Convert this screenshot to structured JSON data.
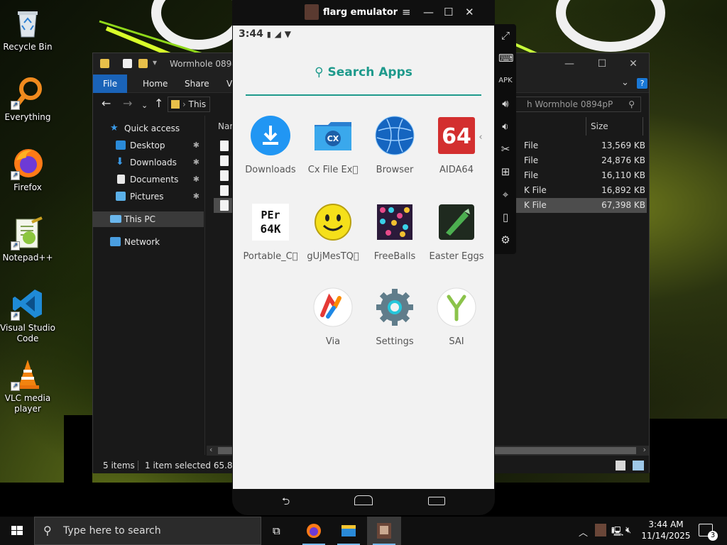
{
  "desktop": {
    "icons": [
      {
        "label": "Recycle Bin"
      },
      {
        "label": "Everything"
      },
      {
        "label": "Firefox"
      },
      {
        "label": "Notepad++"
      },
      {
        "label": "Visual Studio Code"
      },
      {
        "label": "VLC media player"
      }
    ]
  },
  "explorer": {
    "title": "Wormhole 0894p",
    "ribbon_tabs": [
      "File",
      "Home",
      "Share",
      "Vi"
    ],
    "address": "This PC",
    "search_placeholder": "h Wormhole 0894pP",
    "nav": [
      {
        "label": "Quick access",
        "icon": "star-icon"
      },
      {
        "label": "Desktop",
        "icon": "desktop-folder-icon"
      },
      {
        "label": "Downloads",
        "icon": "downloads-folder-icon"
      },
      {
        "label": "Documents",
        "icon": "documents-folder-icon"
      },
      {
        "label": "Pictures",
        "icon": "pictures-folder-icon"
      },
      {
        "label": "This PC",
        "icon": "computer-icon"
      },
      {
        "label": "Network",
        "icon": "network-icon"
      }
    ],
    "columns": {
      "name": "Nar",
      "size": "Size"
    },
    "files": [
      {
        "type": "File",
        "size": "13,569 KB",
        "selected": false
      },
      {
        "type": "File",
        "size": "24,876 KB",
        "selected": false
      },
      {
        "type": "File",
        "size": "16,110 KB",
        "selected": false
      },
      {
        "type": "K File",
        "size": "16,892 KB",
        "selected": false
      },
      {
        "type": "K File",
        "size": "67,398 KB",
        "selected": true
      }
    ],
    "status": {
      "items": "5 items",
      "selected": "1 item selected  65.8 MB"
    }
  },
  "emulator": {
    "title": "flarg emulator",
    "status_time": "3:44",
    "search_label": "Search Apps",
    "apps": [
      {
        "label": "Downloads",
        "icon": "download-icon"
      },
      {
        "label": "Cx File Ex⃞",
        "icon": "cx-file-explorer-icon"
      },
      {
        "label": "Browser",
        "icon": "browser-globe-icon"
      },
      {
        "label": "AIDA64",
        "icon": "aida64-icon"
      },
      {
        "label": "Portable_C⃞",
        "icon": "perf64k-icon"
      },
      {
        "label": "gUjMesTQ⃞",
        "icon": "smiley-icon"
      },
      {
        "label": "FreeBalls",
        "icon": "freeballs-icon"
      },
      {
        "label": "Easter Eggs",
        "icon": "easter-eggs-icon"
      },
      {
        "label": "Via",
        "icon": "via-browser-icon"
      },
      {
        "label": "Settings",
        "icon": "settings-gear-icon"
      },
      {
        "label": "SAI",
        "icon": "sai-icon"
      }
    ]
  },
  "taskbar": {
    "search_placeholder": "Type here to search",
    "time": "3:44 AM",
    "date": "11/14/2025",
    "notifications": "3"
  }
}
